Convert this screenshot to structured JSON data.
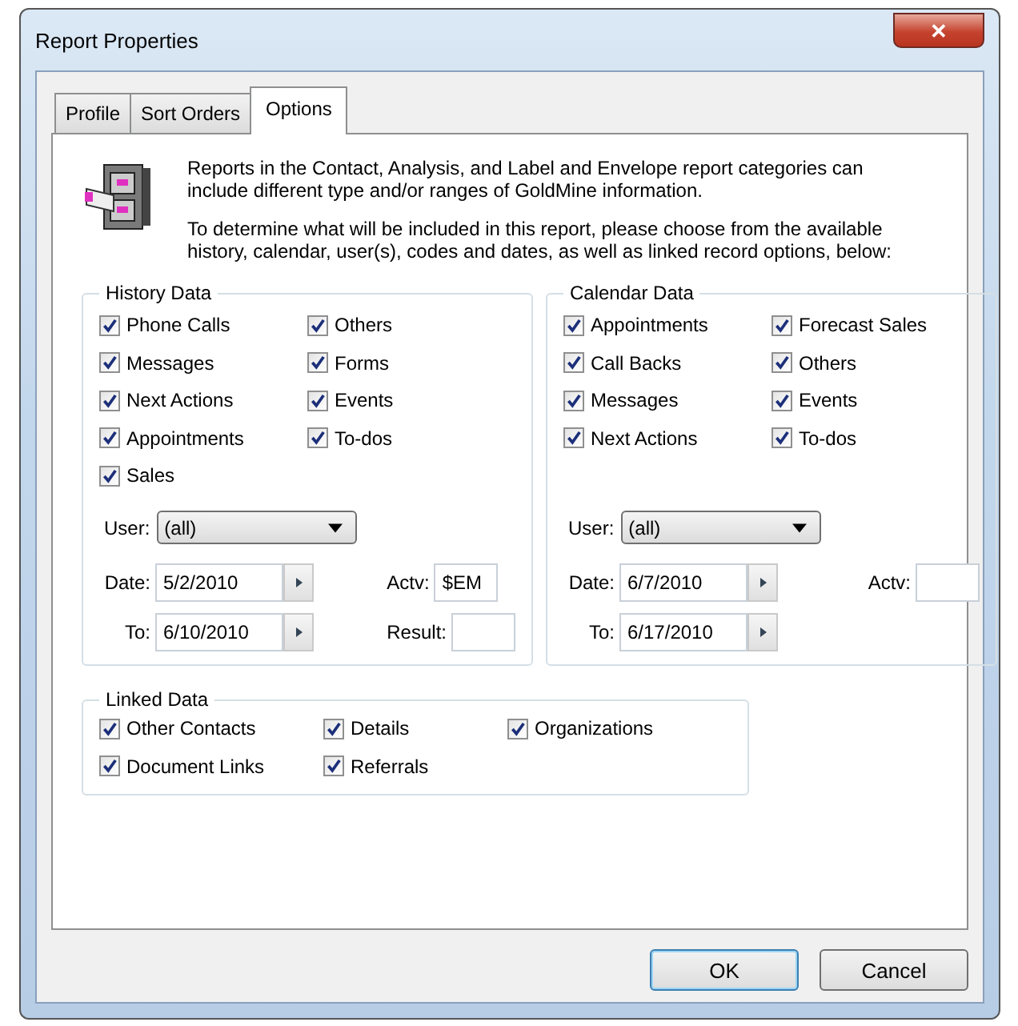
{
  "window": {
    "title": "Report Properties",
    "close": "✕"
  },
  "tabs": [
    {
      "label": "Profile",
      "selected": false
    },
    {
      "label": "Sort Orders",
      "selected": false
    },
    {
      "label": "Options",
      "selected": true
    }
  ],
  "intro": [
    "Reports in the Contact, Analysis, and Label and Envelope report categories can include different type and/or ranges of GoldMine information.",
    "To determine what will be included in this report, please choose from the available history, calendar, user(s), codes and dates, as well as linked record options, below:"
  ],
  "groups": [
    {
      "title": "History Data",
      "columns": [
        [
          {
            "label": "Phone Calls",
            "checked": true
          },
          {
            "label": "Messages",
            "checked": true
          },
          {
            "label": "Next Actions",
            "checked": true
          },
          {
            "label": "Appointments",
            "checked": true
          },
          {
            "label": "Sales",
            "checked": true
          }
        ],
        [
          {
            "label": "Others",
            "checked": true
          },
          {
            "label": "Forms",
            "checked": true
          },
          {
            "label": "Events",
            "checked": true
          },
          {
            "label": "To-dos",
            "checked": true
          }
        ]
      ],
      "user": {
        "label": "User:",
        "value": "(all)"
      },
      "date": {
        "label": "Date:",
        "value": "5/2/2010"
      },
      "to": {
        "label": "To:",
        "value": "6/10/2010"
      },
      "code_fields": [
        {
          "label": "Actv:",
          "value": "$EM"
        },
        {
          "label": "Result:"
        }
      ]
    },
    {
      "title": "Calendar Data",
      "columns": [
        [
          {
            "label": "Appointments",
            "checked": true
          },
          {
            "label": "Call Backs",
            "checked": true
          },
          {
            "label": "Messages",
            "checked": true
          },
          {
            "label": "Next Actions",
            "checked": true
          }
        ],
        [
          {
            "label": "Forecast Sales",
            "checked": true
          },
          {
            "label": "Others",
            "checked": true
          },
          {
            "label": "Events",
            "checked": true
          },
          {
            "label": "To-dos",
            "checked": true
          }
        ]
      ],
      "user": {
        "label": "User:",
        "value": "(all)"
      },
      "date": {
        "label": "Date:",
        "value": "6/7/2010"
      },
      "to": {
        "label": "To:",
        "value": "6/17/2010"
      },
      "code_fields": [
        {
          "label": "Actv:"
        }
      ]
    }
  ],
  "linked": {
    "title": "Linked Data",
    "columns": [
      [
        {
          "label": "Other Contacts",
          "checked": true
        },
        {
          "label": "Document Links",
          "checked": true
        }
      ],
      [
        {
          "label": "Details",
          "checked": true
        },
        {
          "label": "Referrals",
          "checked": true
        }
      ],
      [
        {
          "label": "Organizations",
          "checked": true
        }
      ]
    ]
  },
  "buttons": [
    {
      "label": "OK",
      "default": true
    },
    {
      "label": "Cancel",
      "default": false
    }
  ]
}
